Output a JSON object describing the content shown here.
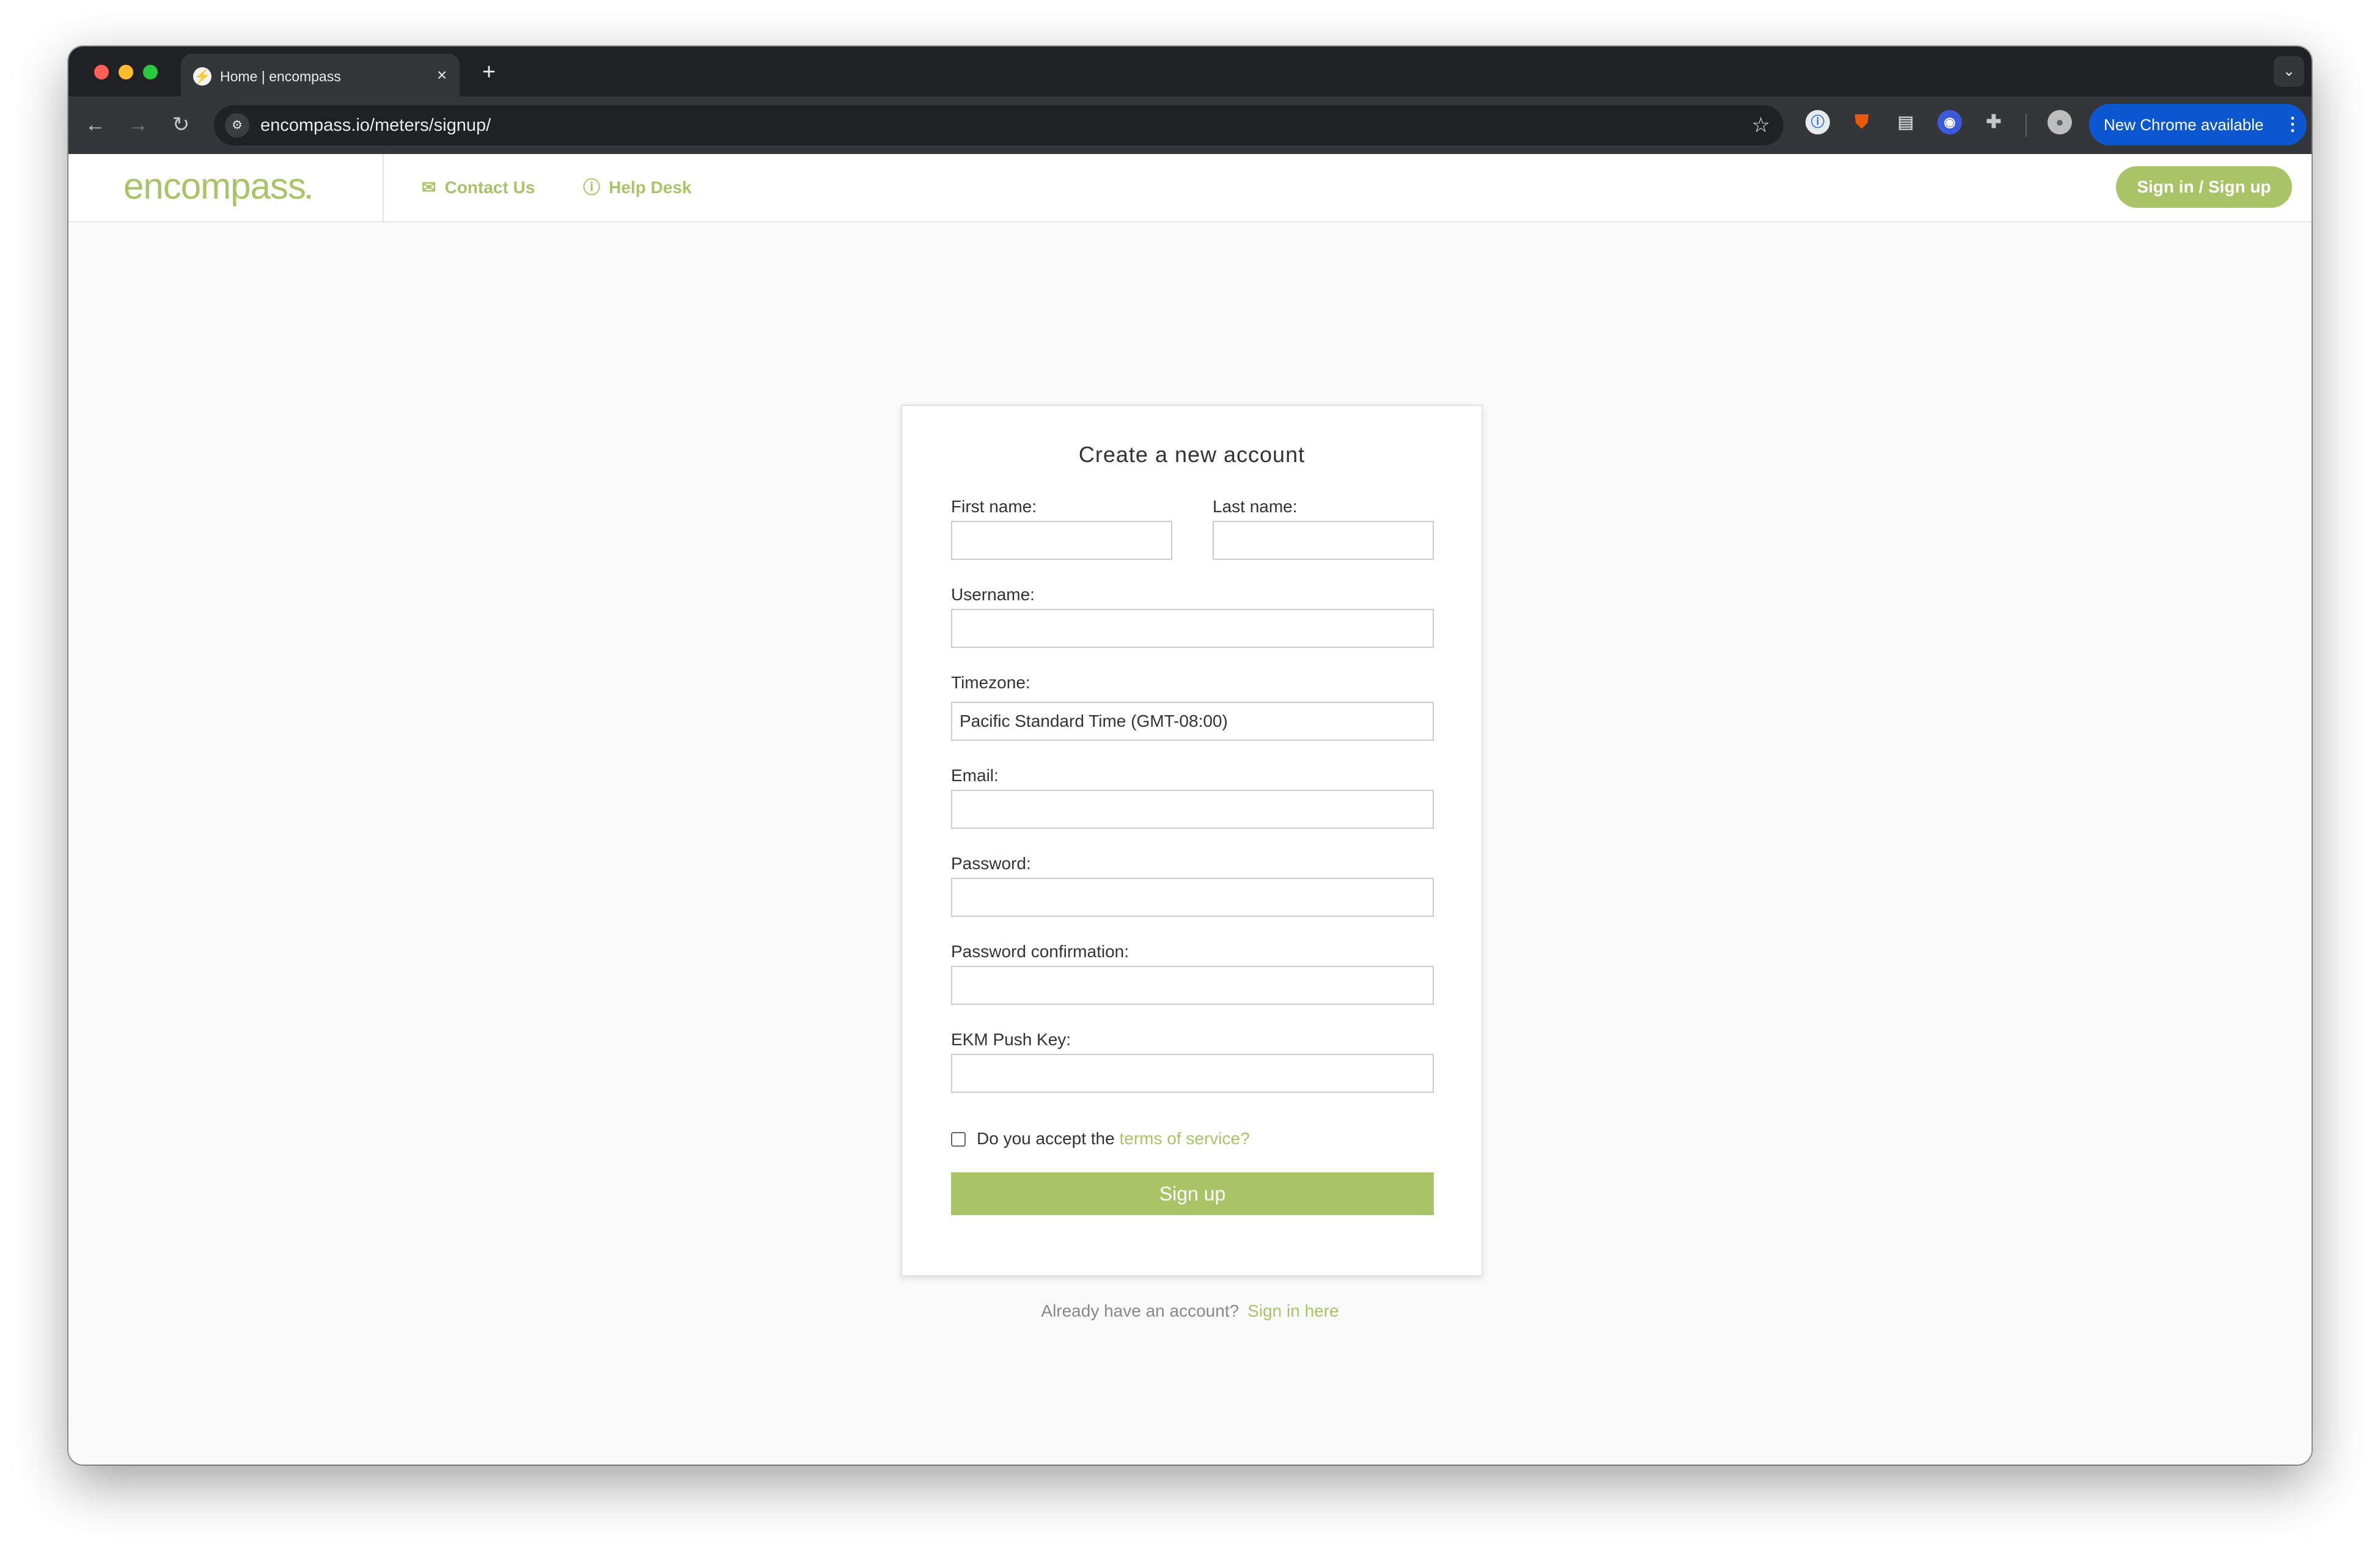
{
  "browser": {
    "tab_title": "Home | encompass",
    "url": "encompass.io/meters/signup/",
    "update_label": "New Chrome available"
  },
  "site": {
    "logo": "encompass",
    "nav": {
      "contact": "Contact Us",
      "help": "Help Desk"
    },
    "signin_label": "Sign in / Sign up",
    "accent_color": "#a8c466"
  },
  "form": {
    "title": "Create a new account",
    "first_name_label": "First name:",
    "last_name_label": "Last name:",
    "username_label": "Username:",
    "timezone_label": "Timezone:",
    "timezone_value": "Pacific Standard Time (GMT-08:00)",
    "email_label": "Email:",
    "password_label": "Password:",
    "password_confirm_label": "Password confirmation:",
    "push_key_label": "EKM Push Key:",
    "tos_prefix": "Do you accept the",
    "tos_link": "terms of service?",
    "submit_label": "Sign up"
  },
  "footer": {
    "prompt": "Already have an account?",
    "link": "Sign in here"
  }
}
